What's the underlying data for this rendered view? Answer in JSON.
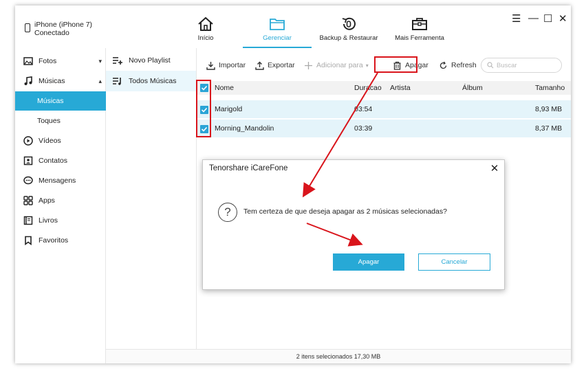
{
  "device": {
    "name": "iPhone (iPhone 7)",
    "status": "Conectado"
  },
  "nav": [
    {
      "label": "Início",
      "icon": "home-icon"
    },
    {
      "label": "Gerenciar",
      "icon": "folder-icon"
    },
    {
      "label": "Backup & Restaurar",
      "icon": "backup-icon"
    },
    {
      "label": "Mais Ferramenta",
      "icon": "toolbox-icon"
    }
  ],
  "window_controls": {
    "menu": "☰",
    "minimize": "—",
    "maximize": "☐",
    "close": "✕"
  },
  "sidebar": {
    "items": [
      {
        "label": "Fotos",
        "icon": "photo-icon"
      },
      {
        "label": "Músicas",
        "icon": "music-icon"
      },
      {
        "label": "Músicas"
      },
      {
        "label": "Toques"
      },
      {
        "label": "Vídeos",
        "icon": "video-icon"
      },
      {
        "label": "Contatos",
        "icon": "contacts-icon"
      },
      {
        "label": "Mensagens",
        "icon": "messages-icon"
      },
      {
        "label": "Apps",
        "icon": "apps-icon"
      },
      {
        "label": "Livros",
        "icon": "books-icon"
      },
      {
        "label": "Favoritos",
        "icon": "bookmark-icon"
      }
    ]
  },
  "playlists": [
    {
      "label": "Novo Playlist",
      "icon": "add-playlist-icon"
    },
    {
      "label": "Todos Músicas",
      "icon": "playlist-icon"
    }
  ],
  "toolbar": {
    "import": "Importar",
    "export": "Exportar",
    "add_to": "Adicionar para",
    "delete": "Apagar",
    "refresh": "Refresh",
    "search_placeholder": "Buscar"
  },
  "table": {
    "columns": [
      "Nome",
      "Duracao",
      "Artista",
      "Álbum",
      "Tamanho"
    ],
    "rows": [
      {
        "name": "Marigold",
        "duration": "03:54",
        "artist": "",
        "album": "",
        "size": "8,93 MB",
        "checked": true
      },
      {
        "name": "Morning_Mandolin",
        "duration": "03:39",
        "artist": "",
        "album": "",
        "size": "8,37 MB",
        "checked": true
      }
    ]
  },
  "status": "2 itens selecionados 17,30 MB",
  "dialog": {
    "title": "Tenorshare iCareFone",
    "message": "Tem certeza de que deseja apagar as 2 músicas selecionadas?",
    "confirm": "Apagar",
    "cancel": "Cancelar",
    "close": "✕",
    "question_mark": "?"
  },
  "colors": {
    "accent": "#27a9d6",
    "selection_row": "#e4f4fa",
    "annotation": "#d9141b"
  }
}
